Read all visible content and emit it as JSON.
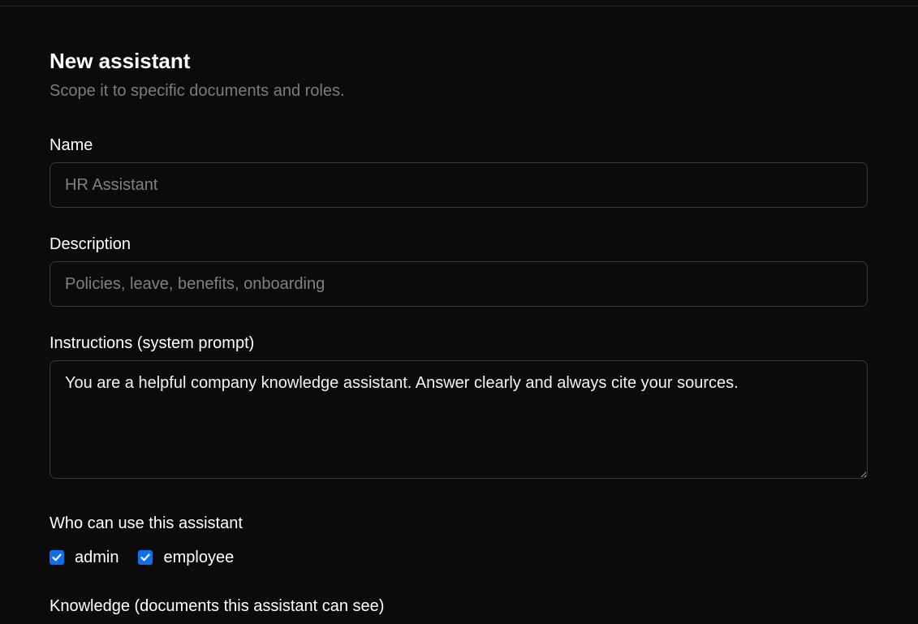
{
  "form": {
    "title": "New assistant",
    "subtitle": "Scope it to specific documents and roles.",
    "name": {
      "label": "Name",
      "value": "",
      "placeholder": "HR Assistant"
    },
    "description": {
      "label": "Description",
      "value": "",
      "placeholder": "Policies, leave, benefits, onboarding"
    },
    "instructions": {
      "label": "Instructions (system prompt)",
      "value": "You are a helpful company knowledge assistant. Answer clearly and always cite your sources."
    },
    "access": {
      "label": "Who can use this assistant",
      "roles": [
        {
          "label": "admin",
          "checked": true
        },
        {
          "label": "employee",
          "checked": true
        }
      ]
    },
    "knowledge": {
      "label": "Knowledge (documents this assistant can see)"
    }
  },
  "colors": {
    "background": "#0b0b0b",
    "border": "#3a3a3a",
    "accent": "#0a6ff0",
    "muted": "#7c7c7c"
  }
}
